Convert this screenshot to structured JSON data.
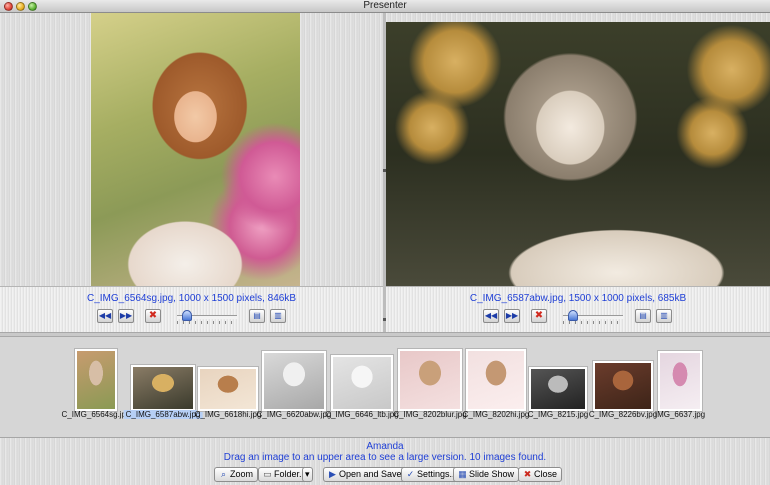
{
  "window": {
    "title": "Presenter"
  },
  "left_viewer": {
    "info": "C_IMG_6564sg.jpg,  1000 x 1500 pixels, 846kB",
    "zoom_level": 0.1
  },
  "right_viewer": {
    "info": "C_IMG_6587abw.jpg,  1500 x 1000 pixels, 685kB",
    "zoom_level": 0.1
  },
  "controls": {
    "prev_icon": "◀◀",
    "next_icon": "▶▶",
    "remove_icon": "✖",
    "save_icon": "▤",
    "save_as_icon": "▥"
  },
  "thumbnails": [
    {
      "name": "C_IMG_6564sg.jpg",
      "selected": false,
      "colors": [
        "#c79b6f",
        "#8a9a54",
        "#d7bea6"
      ]
    },
    {
      "name": "C_IMG_6587abw.jpg",
      "selected": true,
      "colors": [
        "#8a7c66",
        "#3a3a2c",
        "#d8b062"
      ]
    },
    {
      "name": "C_IMG_6618hi.jpg",
      "selected": false,
      "colors": [
        "#e8d4bf",
        "#f3e6d6",
        "#b87e4c"
      ]
    },
    {
      "name": "C_IMG_6620abw.jpg",
      "selected": false,
      "colors": [
        "#d9d9d9",
        "#a8a8a8",
        "#f0f0f0"
      ]
    },
    {
      "name": "C_IMG_6646_ltb.jpg",
      "selected": false,
      "colors": [
        "#e4e4e4",
        "#c8c8c8",
        "#f6f6f6"
      ]
    },
    {
      "name": "C_IMG_8202blur.jpg",
      "selected": false,
      "colors": [
        "#e8c8c8",
        "#f4e0e0",
        "#c9a07a"
      ]
    },
    {
      "name": "C_IMG_8202hi.jpg",
      "selected": false,
      "colors": [
        "#f2e0e0",
        "#fbeeee",
        "#c49873"
      ]
    },
    {
      "name": "C_IMG_8215.jpg",
      "selected": false,
      "colors": [
        "#555555",
        "#222222",
        "#bbbbbb"
      ]
    },
    {
      "name": "C_IMG_8226bv.jpg",
      "selected": false,
      "colors": [
        "#6b3c2c",
        "#3d2418",
        "#a9653c"
      ]
    },
    {
      "name": "IMG_6637.jpg",
      "selected": false,
      "colors": [
        "#e5d6e0",
        "#f5eef2",
        "#d58ab0"
      ]
    }
  ],
  "status": {
    "name": "Amanda",
    "message": "Drag an image to an upper area to see a large version. 10 images found."
  },
  "toolbar": {
    "zoom": {
      "label": "Zoom",
      "icon": "⌕"
    },
    "folder": {
      "label": "Folder...",
      "icon": "▭",
      "menu_icon": "▾"
    },
    "open_save": {
      "label": "Open and Save",
      "icon": "▶"
    },
    "settings": {
      "label": "Settings...",
      "icon": "✓"
    },
    "slideshow": {
      "label": "Slide Show",
      "icon": "▦"
    },
    "close": {
      "label": "Close",
      "icon": "✖"
    }
  }
}
